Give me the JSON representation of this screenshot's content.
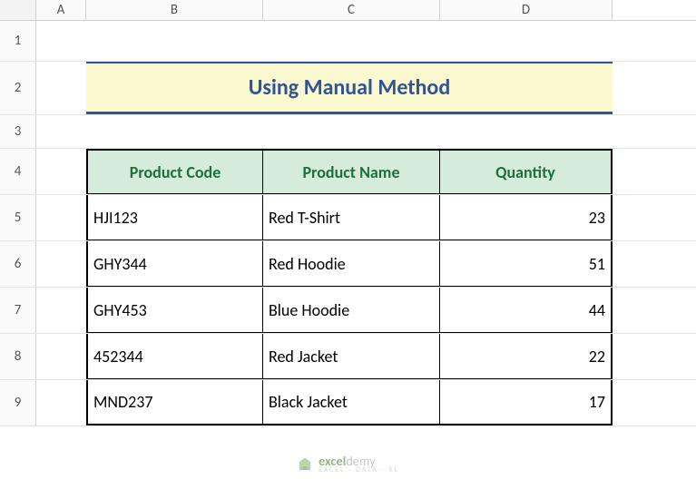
{
  "columns": {
    "A": "A",
    "B": "B",
    "C": "C",
    "D": "D"
  },
  "rows": [
    "1",
    "2",
    "3",
    "4",
    "5",
    "6",
    "7",
    "8",
    "9"
  ],
  "title": "Using Manual Method",
  "headers": {
    "code": "Product Code",
    "name": "Product Name",
    "qty": "Quantity"
  },
  "data": [
    {
      "code": "HJI123",
      "name": "Red T-Shirt",
      "qty": "23"
    },
    {
      "code": "GHY344",
      "name": "Red Hoodie",
      "qty": "51"
    },
    {
      "code": "GHY453",
      "name": "Blue Hoodie",
      "qty": "44"
    },
    {
      "code": "452344",
      "name": "Red Jacket",
      "qty": "22"
    },
    {
      "code": "MND237",
      "name": "Black Jacket",
      "qty": "17"
    }
  ],
  "watermark": {
    "brand_bold": "excel",
    "brand_rest": "demy",
    "tag": "EXCEL · DATA · XL"
  },
  "chart_data": {
    "type": "table",
    "title": "Using Manual Method",
    "columns": [
      "Product Code",
      "Product Name",
      "Quantity"
    ],
    "rows": [
      [
        "HJI123",
        "Red T-Shirt",
        23
      ],
      [
        "GHY344",
        "Red Hoodie",
        51
      ],
      [
        "GHY453",
        "Blue Hoodie",
        44
      ],
      [
        "452344",
        "Red Jacket",
        22
      ],
      [
        "MND237",
        "Black Jacket",
        17
      ]
    ]
  }
}
